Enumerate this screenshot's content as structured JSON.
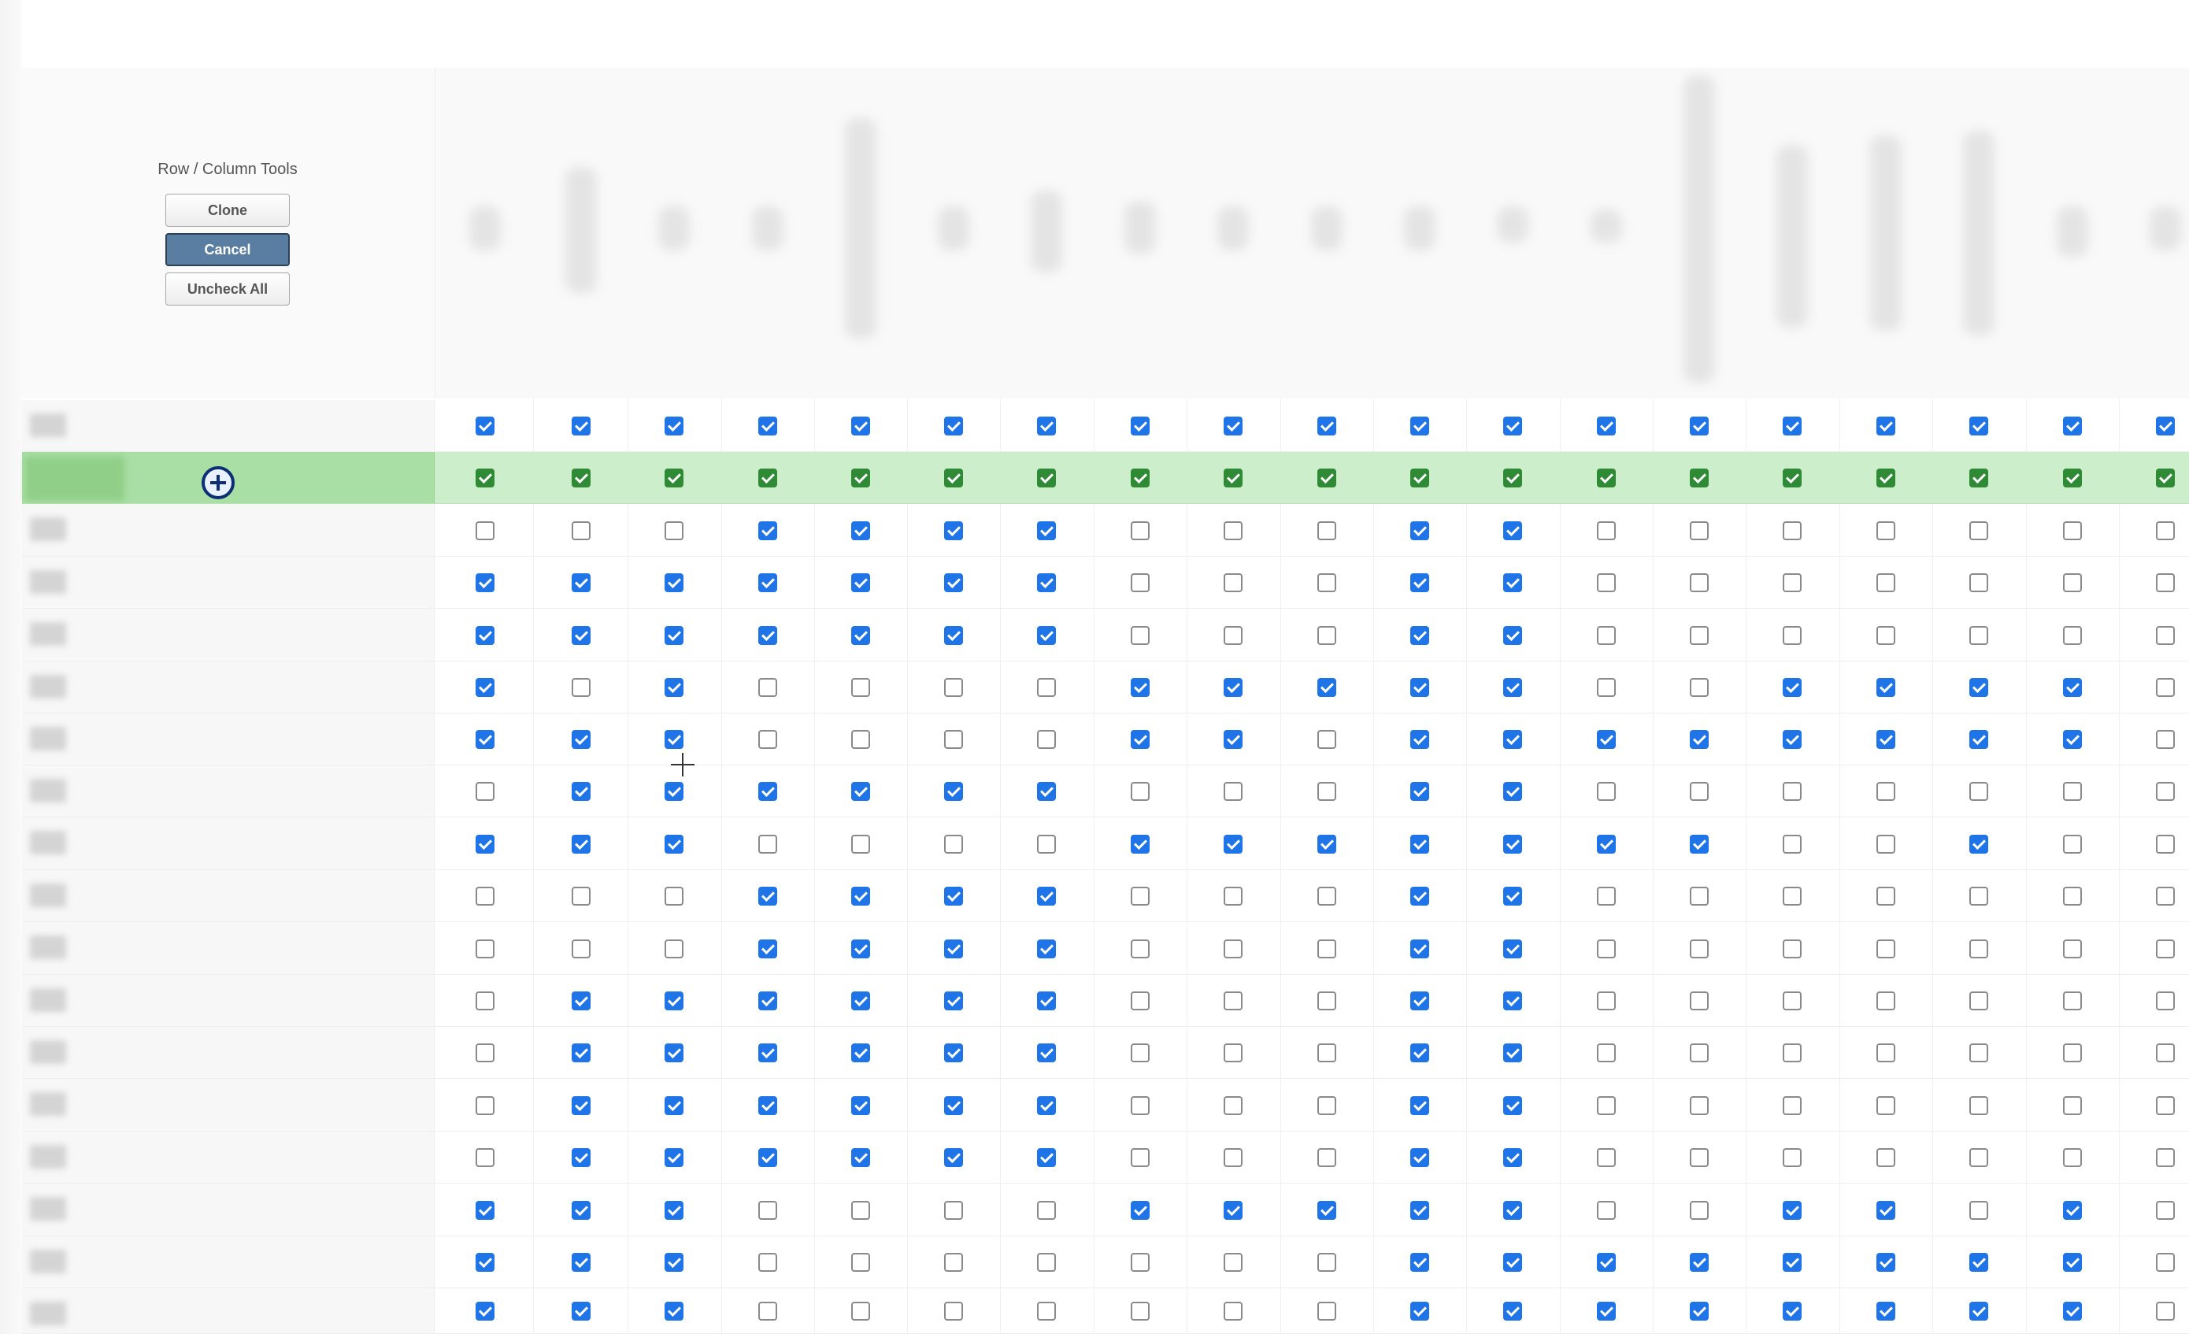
{
  "tools": {
    "title": "Row / Column Tools",
    "clone_label": "Clone",
    "cancel_label": "Cancel",
    "uncheck_all_label": "Uncheck All"
  },
  "colors": {
    "checkbox_checked": "#1f74e8",
    "checkbox_checked_selected_row": "#2f8a35",
    "selected_row_background": "#cdeecb",
    "selected_row_name_cell": "#a9dea4",
    "primary_button": "#5a7ea2"
  },
  "icons": {
    "row_action": "add-circle-icon",
    "cursor": "crosshair-cursor-icon"
  },
  "column_count": 19,
  "selected_row_index": 1,
  "rows": [
    {
      "name": "",
      "checks": [
        1,
        1,
        1,
        1,
        1,
        1,
        1,
        1,
        1,
        1,
        1,
        1,
        1,
        1,
        1,
        1,
        1,
        1,
        1
      ]
    },
    {
      "name": "",
      "checks": [
        1,
        1,
        1,
        1,
        1,
        1,
        1,
        1,
        1,
        1,
        1,
        1,
        1,
        1,
        1,
        1,
        1,
        1,
        1
      ]
    },
    {
      "name": "",
      "checks": [
        0,
        0,
        0,
        1,
        1,
        1,
        1,
        0,
        0,
        0,
        1,
        1,
        0,
        0,
        0,
        0,
        0,
        0,
        0
      ]
    },
    {
      "name": "",
      "checks": [
        1,
        1,
        1,
        1,
        1,
        1,
        1,
        0,
        0,
        0,
        1,
        1,
        0,
        0,
        0,
        0,
        0,
        0,
        0
      ]
    },
    {
      "name": "",
      "checks": [
        1,
        1,
        1,
        1,
        1,
        1,
        1,
        0,
        0,
        0,
        1,
        1,
        0,
        0,
        0,
        0,
        0,
        0,
        0
      ]
    },
    {
      "name": "",
      "checks": [
        1,
        0,
        1,
        0,
        0,
        0,
        0,
        1,
        1,
        1,
        1,
        1,
        0,
        0,
        1,
        1,
        1,
        1,
        0
      ]
    },
    {
      "name": "",
      "checks": [
        1,
        1,
        1,
        0,
        0,
        0,
        0,
        1,
        1,
        0,
        1,
        1,
        1,
        1,
        1,
        1,
        1,
        1,
        0
      ]
    },
    {
      "name": "",
      "checks": [
        0,
        1,
        1,
        1,
        1,
        1,
        1,
        0,
        0,
        0,
        1,
        1,
        0,
        0,
        0,
        0,
        0,
        0,
        0
      ]
    },
    {
      "name": "",
      "checks": [
        1,
        1,
        1,
        0,
        0,
        0,
        0,
        1,
        1,
        1,
        1,
        1,
        1,
        1,
        0,
        0,
        1,
        0,
        0
      ]
    },
    {
      "name": "",
      "checks": [
        0,
        0,
        0,
        1,
        1,
        1,
        1,
        0,
        0,
        0,
        1,
        1,
        0,
        0,
        0,
        0,
        0,
        0,
        0
      ]
    },
    {
      "name": "",
      "checks": [
        0,
        0,
        0,
        1,
        1,
        1,
        1,
        0,
        0,
        0,
        1,
        1,
        0,
        0,
        0,
        0,
        0,
        0,
        0
      ]
    },
    {
      "name": "",
      "checks": [
        0,
        1,
        1,
        1,
        1,
        1,
        1,
        0,
        0,
        0,
        1,
        1,
        0,
        0,
        0,
        0,
        0,
        0,
        0
      ]
    },
    {
      "name": "",
      "checks": [
        0,
        1,
        1,
        1,
        1,
        1,
        1,
        0,
        0,
        0,
        1,
        1,
        0,
        0,
        0,
        0,
        0,
        0,
        0
      ]
    },
    {
      "name": "",
      "checks": [
        0,
        1,
        1,
        1,
        1,
        1,
        1,
        0,
        0,
        0,
        1,
        1,
        0,
        0,
        0,
        0,
        0,
        0,
        0
      ]
    },
    {
      "name": "",
      "checks": [
        0,
        1,
        1,
        1,
        1,
        1,
        1,
        0,
        0,
        0,
        1,
        1,
        0,
        0,
        0,
        0,
        0,
        0,
        0
      ]
    },
    {
      "name": "",
      "checks": [
        1,
        1,
        1,
        0,
        0,
        0,
        0,
        1,
        1,
        1,
        1,
        1,
        0,
        0,
        1,
        1,
        0,
        1,
        0
      ]
    },
    {
      "name": "",
      "checks": [
        1,
        1,
        1,
        0,
        0,
        0,
        0,
        0,
        0,
        0,
        1,
        1,
        1,
        1,
        1,
        1,
        1,
        1,
        0
      ]
    },
    {
      "name": "",
      "checks": [
        1,
        1,
        1,
        0,
        0,
        0,
        0,
        0,
        0,
        0,
        1,
        1,
        1,
        1,
        1,
        1,
        1,
        1,
        0
      ]
    }
  ]
}
